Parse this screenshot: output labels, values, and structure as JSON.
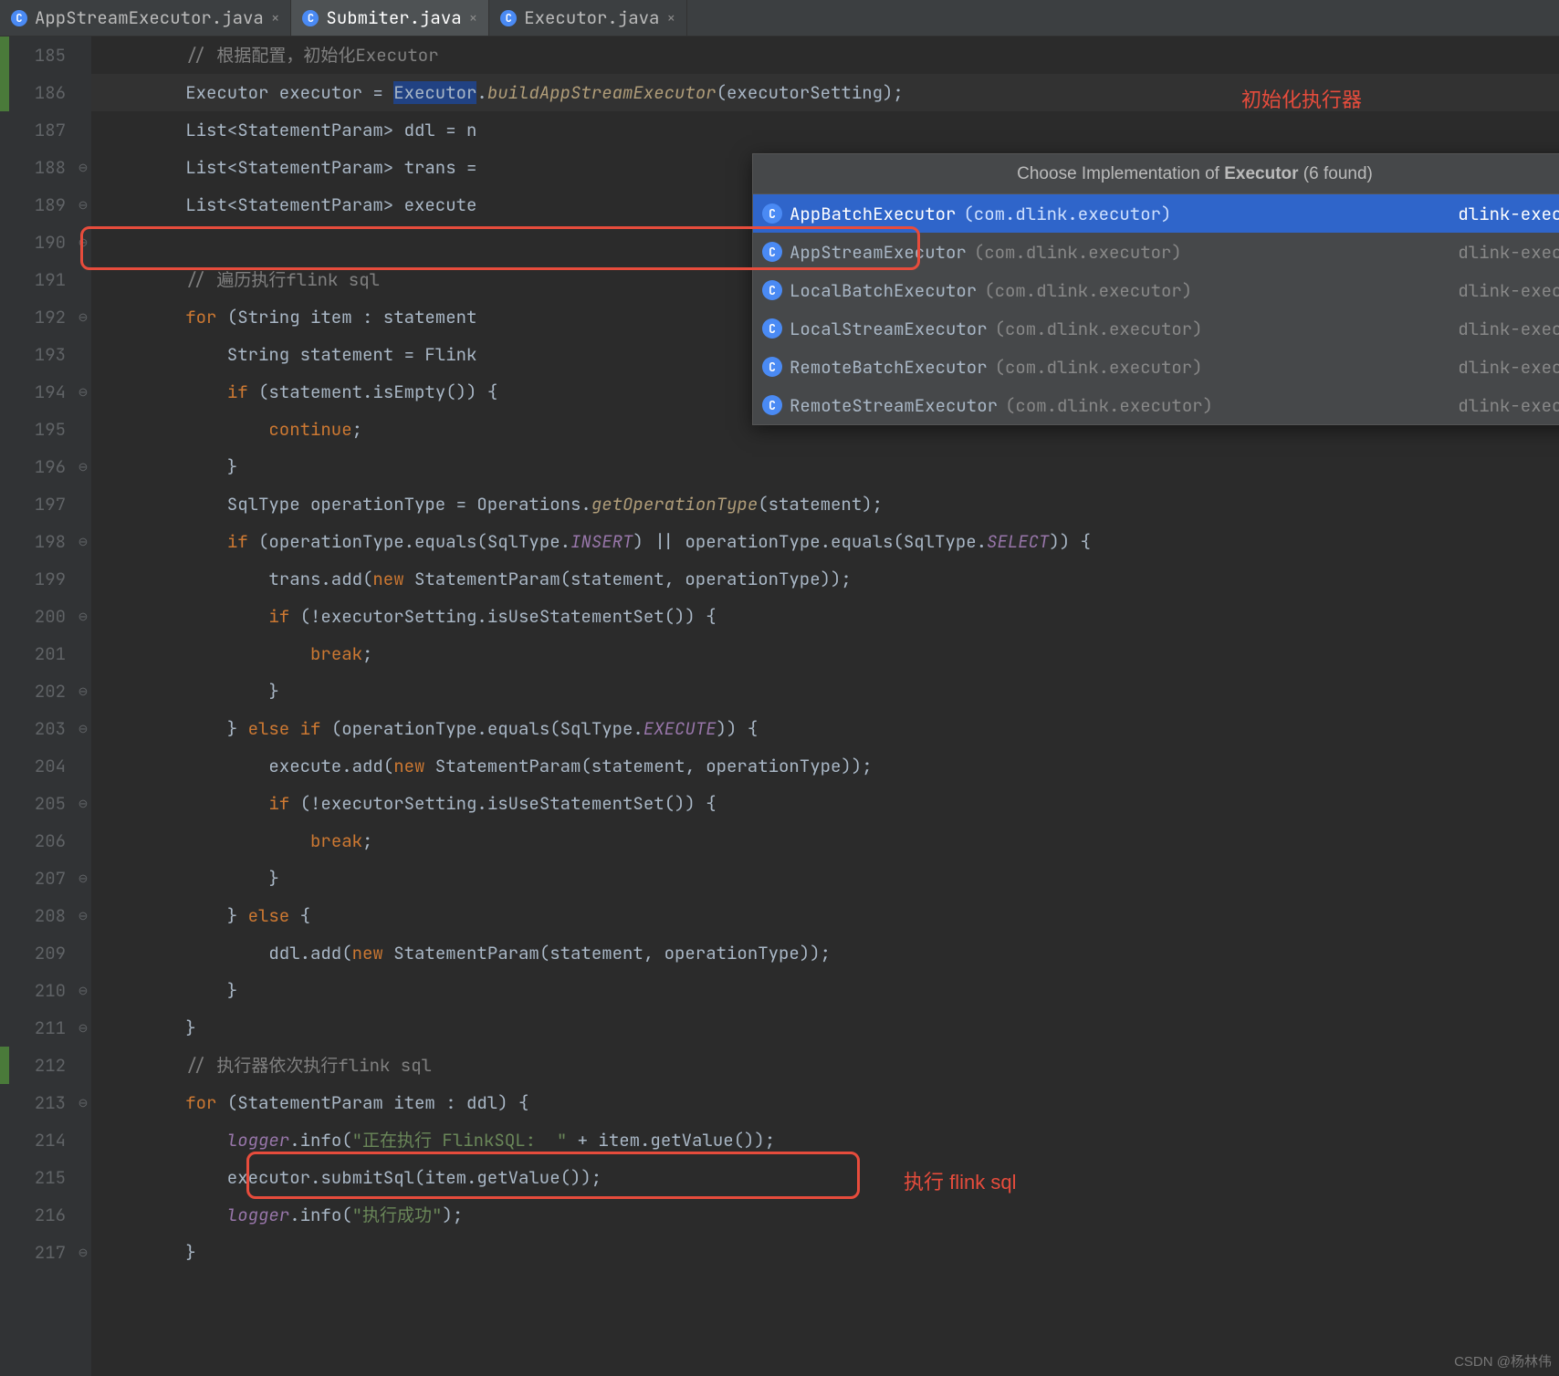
{
  "tabs": [
    {
      "label": "AppStreamExecutor.java",
      "active": false
    },
    {
      "label": "Submiter.java",
      "active": true
    },
    {
      "label": "Executor.java",
      "active": false
    }
  ],
  "popup": {
    "title_prefix": "Choose Implementation of ",
    "title_bold": "Executor",
    "title_suffix": " (6 found)",
    "items": [
      {
        "name": "AppBatchExecutor",
        "pkg": "(com.dlink.executor)",
        "module": "dlink-executor",
        "selected": true
      },
      {
        "name": "AppStreamExecutor",
        "pkg": "(com.dlink.executor)",
        "module": "dlink-executor",
        "selected": false
      },
      {
        "name": "LocalBatchExecutor",
        "pkg": "(com.dlink.executor)",
        "module": "dlink-executor",
        "selected": false
      },
      {
        "name": "LocalStreamExecutor",
        "pkg": "(com.dlink.executor)",
        "module": "dlink-executor",
        "selected": false
      },
      {
        "name": "RemoteBatchExecutor",
        "pkg": "(com.dlink.executor)",
        "module": "dlink-executor",
        "selected": false
      },
      {
        "name": "RemoteStreamExecutor",
        "pkg": "(com.dlink.executor)",
        "module": "dlink-executor",
        "selected": false
      }
    ]
  },
  "lines": {
    "start": 185,
    "count": 33,
    "highlighted": 186,
    "green_marks": [
      185,
      186,
      212
    ],
    "folds": {
      "188": "⊖",
      "189": "⊖",
      "190": "⊖",
      "192": "⊖",
      "194": "⊖",
      "196": "⊖",
      "198": "⊖",
      "200": "⊖",
      "202": "⊖",
      "203": "⊖",
      "205": "⊖",
      "207": "⊖",
      "208": "⊖",
      "210": "⊖",
      "211": "⊖",
      "213": "⊖",
      "217": "⊖"
    }
  },
  "code": {
    "185": [
      {
        "t": "        ",
        "c": ""
      },
      {
        "t": "// 根据配置，初始化Executor",
        "c": "cmt"
      }
    ],
    "186": [
      {
        "t": "        Executor executor = ",
        "c": ""
      },
      {
        "t": "Executor",
        "c": "sel"
      },
      {
        "t": ".",
        "c": ""
      },
      {
        "t": "buildAppStreamExecutor",
        "c": "itcall"
      },
      {
        "t": "(executorSetting);",
        "c": ""
      }
    ],
    "187": [
      {
        "t": "        List<StatementParam> ddl = n",
        "c": ""
      }
    ],
    "188": [
      {
        "t": "        List<StatementParam> trans =",
        "c": ""
      }
    ],
    "189": [
      {
        "t": "        List<StatementParam> execute",
        "c": ""
      }
    ],
    "190": [
      {
        "t": "",
        "c": ""
      }
    ],
    "191": [
      {
        "t": "        ",
        "c": ""
      },
      {
        "t": "// 遍历执行flink sql",
        "c": "cmt"
      }
    ],
    "192": [
      {
        "t": "        ",
        "c": ""
      },
      {
        "t": "for",
        "c": "kw"
      },
      {
        "t": " (String item : statement",
        "c": ""
      }
    ],
    "193": [
      {
        "t": "            String statement = Flink",
        "c": ""
      }
    ],
    "194": [
      {
        "t": "            ",
        "c": ""
      },
      {
        "t": "if",
        "c": "kw"
      },
      {
        "t": " (statement.isEmpty()) {",
        "c": ""
      }
    ],
    "195": [
      {
        "t": "                ",
        "c": ""
      },
      {
        "t": "continue",
        "c": "kw"
      },
      {
        "t": ";",
        "c": ""
      }
    ],
    "196": [
      {
        "t": "            }",
        "c": ""
      }
    ],
    "197": [
      {
        "t": "            SqlType operationType = Operations.",
        "c": ""
      },
      {
        "t": "getOperationType",
        "c": "itcall"
      },
      {
        "t": "(statement);",
        "c": ""
      }
    ],
    "198": [
      {
        "t": "            ",
        "c": ""
      },
      {
        "t": "if",
        "c": "kw"
      },
      {
        "t": " (operationType.equals(SqlType.",
        "c": ""
      },
      {
        "t": "INSERT",
        "c": "const"
      },
      {
        "t": ") || operationType.equals(SqlType.",
        "c": ""
      },
      {
        "t": "SELECT",
        "c": "const"
      },
      {
        "t": ")) {",
        "c": ""
      }
    ],
    "199": [
      {
        "t": "                trans.add(",
        "c": ""
      },
      {
        "t": "new",
        "c": "kw"
      },
      {
        "t": " StatementParam(statement, operationType));",
        "c": ""
      }
    ],
    "200": [
      {
        "t": "                ",
        "c": ""
      },
      {
        "t": "if",
        "c": "kw"
      },
      {
        "t": " (!executorSetting.isUseStatementSet()) {",
        "c": ""
      }
    ],
    "201": [
      {
        "t": "                    ",
        "c": ""
      },
      {
        "t": "break",
        "c": "kw"
      },
      {
        "t": ";",
        "c": ""
      }
    ],
    "202": [
      {
        "t": "                }",
        "c": ""
      }
    ],
    "203": [
      {
        "t": "            } ",
        "c": ""
      },
      {
        "t": "else if",
        "c": "kw"
      },
      {
        "t": " (operationType.equals(SqlType.",
        "c": ""
      },
      {
        "t": "EXECUTE",
        "c": "const"
      },
      {
        "t": ")) {",
        "c": ""
      }
    ],
    "204": [
      {
        "t": "                execute.add(",
        "c": ""
      },
      {
        "t": "new",
        "c": "kw"
      },
      {
        "t": " StatementParam(statement, operationType));",
        "c": ""
      }
    ],
    "205": [
      {
        "t": "                ",
        "c": ""
      },
      {
        "t": "if",
        "c": "kw"
      },
      {
        "t": " (!executorSetting.isUseStatementSet()) {",
        "c": ""
      }
    ],
    "206": [
      {
        "t": "                    ",
        "c": ""
      },
      {
        "t": "break",
        "c": "kw"
      },
      {
        "t": ";",
        "c": ""
      }
    ],
    "207": [
      {
        "t": "                }",
        "c": ""
      }
    ],
    "208": [
      {
        "t": "            } ",
        "c": ""
      },
      {
        "t": "else",
        "c": "kw"
      },
      {
        "t": " {",
        "c": ""
      }
    ],
    "209": [
      {
        "t": "                ddl.add(",
        "c": ""
      },
      {
        "t": "new",
        "c": "kw"
      },
      {
        "t": " StatementParam(statement, operationType));",
        "c": ""
      }
    ],
    "210": [
      {
        "t": "            }",
        "c": ""
      }
    ],
    "211": [
      {
        "t": "        }",
        "c": ""
      }
    ],
    "212": [
      {
        "t": "        ",
        "c": ""
      },
      {
        "t": "// 执行器依次执行flink sql",
        "c": "cmt"
      }
    ],
    "213": [
      {
        "t": "        ",
        "c": ""
      },
      {
        "t": "for",
        "c": "kw"
      },
      {
        "t": " (StatementParam item : ddl) {",
        "c": ""
      }
    ],
    "214": [
      {
        "t": "            ",
        "c": ""
      },
      {
        "t": "logger",
        "c": "it"
      },
      {
        "t": ".info(",
        "c": ""
      },
      {
        "t": "\"正在执行 FlinkSQL:  \"",
        "c": "str"
      },
      {
        "t": " + item.getValue());",
        "c": ""
      }
    ],
    "215": [
      {
        "t": "            executor.submitSql(item.getValue());",
        "c": ""
      }
    ],
    "216": [
      {
        "t": "            ",
        "c": ""
      },
      {
        "t": "logger",
        "c": "it"
      },
      {
        "t": ".info(",
        "c": ""
      },
      {
        "t": "\"执行成功\"",
        "c": "str"
      },
      {
        "t": ");",
        "c": ""
      }
    ],
    "217": [
      {
        "t": "        }",
        "c": ""
      }
    ]
  },
  "annotations": {
    "a1": "初始化执行器",
    "a2": "执行 flink sql"
  },
  "watermark": "CSDN @杨林伟"
}
